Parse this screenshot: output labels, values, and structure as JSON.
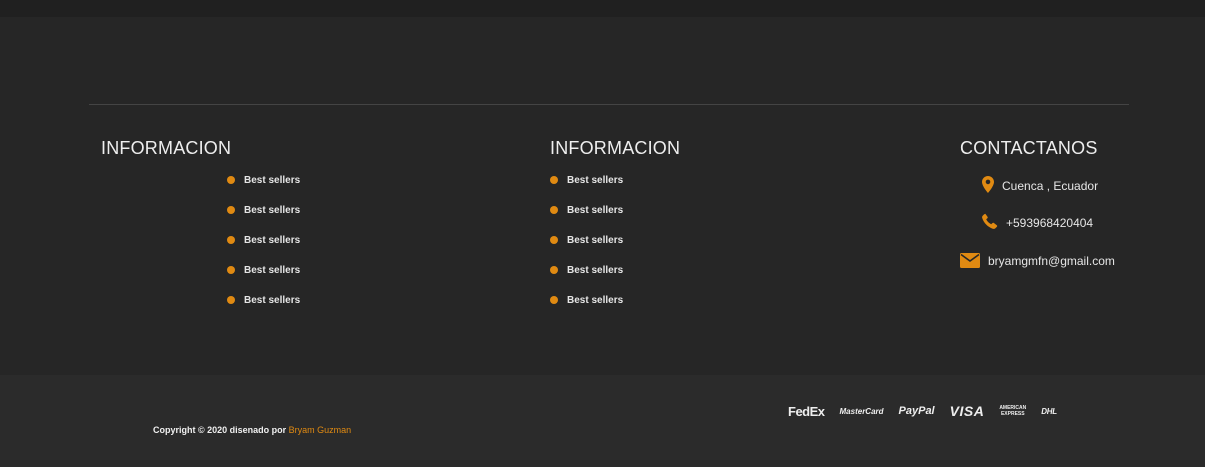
{
  "footer": {
    "columns": [
      {
        "title": "INFORMACION",
        "links": [
          "Best sellers",
          "Best sellers",
          "Best sellers",
          "Best sellers",
          "Best sellers"
        ]
      },
      {
        "title": "INFORMACION",
        "links": [
          "Best sellers",
          "Best sellers",
          "Best sellers",
          "Best sellers",
          "Best sellers"
        ]
      }
    ],
    "contact": {
      "title": "CONTACTANOS",
      "location": "Cuenca , Ecuador",
      "phone": "+593968420404",
      "email": "bryamgmfn@gmail.com"
    }
  },
  "bottom_bar": {
    "copyright_prefix": "Copyright © 2020 disenado por",
    "author": "Bryam Guzman",
    "payments": {
      "fedex": "FedEx",
      "mastercard": "MasterCard",
      "paypal": "PayPal",
      "visa": "VISA",
      "amex_line1": "AMERICAN",
      "amex_line2": "EXPRESS",
      "dhl": "DHL"
    }
  },
  "colors": {
    "background": "#262626",
    "accent": "#e08a12",
    "bottom_background": "#2b2b2b"
  }
}
